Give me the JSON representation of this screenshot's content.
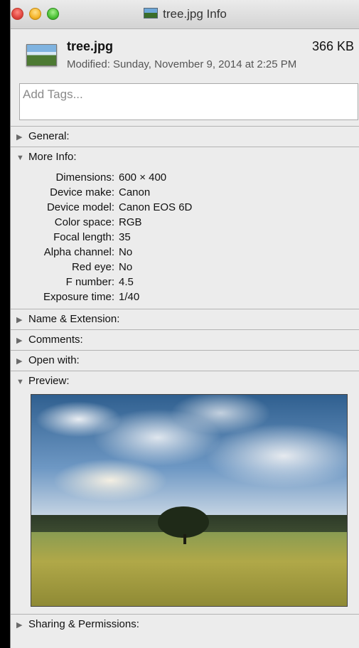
{
  "window": {
    "title": "tree.jpg Info"
  },
  "file": {
    "name": "tree.jpg",
    "size": "366 KB",
    "modified": "Modified: Sunday, November 9, 2014 at 2:25 PM"
  },
  "tags": {
    "placeholder": "Add Tags..."
  },
  "sections": {
    "general": "General:",
    "more_info": "More Info:",
    "name_ext": "Name & Extension:",
    "comments": "Comments:",
    "open_with": "Open with:",
    "preview": "Preview:",
    "sharing": "Sharing & Permissions:"
  },
  "more_info": [
    {
      "label": "Dimensions:",
      "value": "600 × 400"
    },
    {
      "label": "Device make:",
      "value": "Canon"
    },
    {
      "label": "Device model:",
      "value": "Canon EOS 6D"
    },
    {
      "label": "Color space:",
      "value": "RGB"
    },
    {
      "label": "Focal length:",
      "value": "35"
    },
    {
      "label": "Alpha channel:",
      "value": "No"
    },
    {
      "label": "Red eye:",
      "value": "No"
    },
    {
      "label": "F number:",
      "value": "4.5"
    },
    {
      "label": "Exposure time:",
      "value": "1/40"
    }
  ],
  "icons": {
    "collapsed": "▶",
    "expanded": "▼"
  }
}
